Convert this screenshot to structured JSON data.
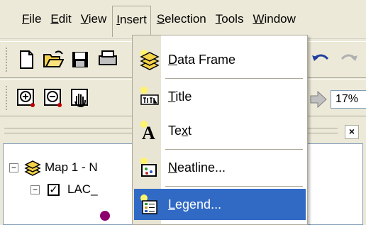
{
  "menubar": {
    "items": [
      {
        "label": "File",
        "acc": "F",
        "rest": "ile"
      },
      {
        "label": "Edit",
        "acc": "E",
        "rest": "dit"
      },
      {
        "label": "View",
        "acc": "V",
        "rest": "iew"
      },
      {
        "label": "Insert",
        "acc": "I",
        "rest": "nsert"
      },
      {
        "label": "Selection",
        "acc": "S",
        "rest": "election"
      },
      {
        "label": "Tools",
        "acc": "T",
        "rest": "ools"
      },
      {
        "label": "Window",
        "acc": "W",
        "rest": "indow"
      }
    ]
  },
  "toolbar2": {
    "scale_value": "17%"
  },
  "toc": {
    "close_label": "×",
    "rows": {
      "map": {
        "label": "Map 1 - N",
        "expander": "−"
      },
      "layer": {
        "label": "LAC_",
        "expander": "−",
        "checked": "✓"
      }
    },
    "symbol_color": "#8b006e"
  },
  "insert_menu": {
    "items": {
      "data_frame": {
        "acc": "D",
        "rest": "ata Frame"
      },
      "title": {
        "acc": "T",
        "rest": "itle"
      },
      "text": {
        "pre": "Te",
        "acc": "x",
        "rest": "t"
      },
      "neatline": {
        "acc": "N",
        "rest": "eatline..."
      },
      "legend": {
        "acc": "L",
        "rest": "egend..."
      }
    },
    "selected": "legend",
    "highlight_color": "#316ac5"
  }
}
